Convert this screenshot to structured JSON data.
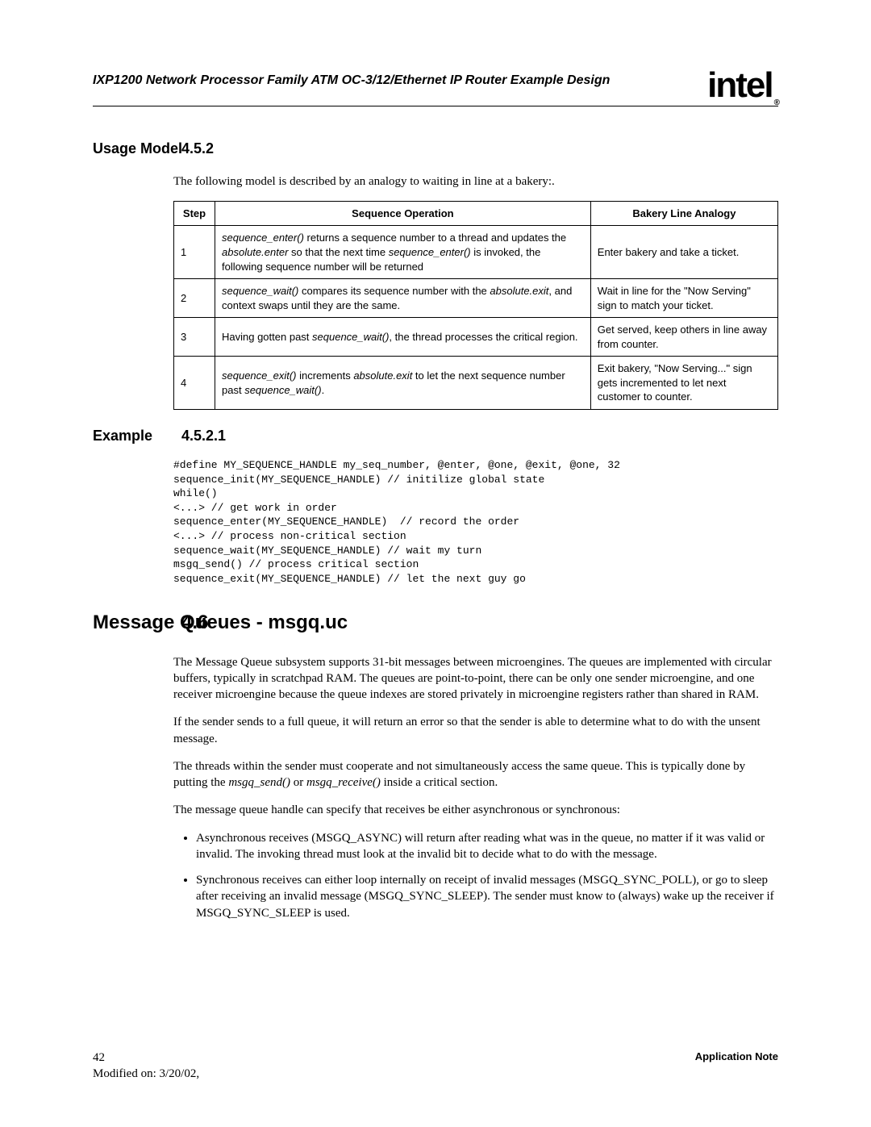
{
  "running_title": "IXP1200 Network Processor Family ATM OC-3/12/Ethernet IP Router Example Design",
  "logo_text": "intel",
  "logo_reg": "®",
  "sec452": {
    "num": "4.5.2",
    "title": "Usage Model"
  },
  "sec452_intro": "The following model is described by an analogy to waiting in line at a bakery:.",
  "table": {
    "h1": "Step",
    "h2": "Sequence Operation",
    "h3": "Bakery Line Analogy",
    "rows": [
      {
        "step": "1",
        "op_html": "<span class='em'>sequence_enter()</span> returns a sequence number to a thread and updates the <span class='em'>absolute.enter</span> so that the next time <span class='em'>sequence_enter()</span> is invoked, the following sequence number will be returned",
        "an": "Enter bakery and take a ticket."
      },
      {
        "step": "2",
        "op_html": "<span class='em'>sequence_wait()</span> compares its sequence number with the <span class='em'>absolute.exit</span>, and context swaps until they are the same.",
        "an": "Wait in line for the \"Now Serving\" sign to match your ticket."
      },
      {
        "step": "3",
        "op_html": "Having gotten past <span class='em'>sequence_wait()</span>, the thread processes the critical region.",
        "an": "Get served, keep others in line away from counter."
      },
      {
        "step": "4",
        "op_html": "<span class='em'>sequence_exit()</span> increments <span class='em'>absolute.exit</span> to let the next sequence number past <span class='em'>sequence_wait()</span>.",
        "an": "Exit bakery, \"Now Serving...\" sign gets incremented to let next customer to counter."
      }
    ]
  },
  "sec4521": {
    "num": "4.5.2.1",
    "title": "Example"
  },
  "code": "#define MY_SEQUENCE_HANDLE my_seq_number, @enter, @one, @exit, @one, 32\nsequence_init(MY_SEQUENCE_HANDLE) // initilize global state\nwhile()\n<...> // get work in order\nsequence_enter(MY_SEQUENCE_HANDLE)  // record the order\n<...> // process non-critical section\nsequence_wait(MY_SEQUENCE_HANDLE) // wait my turn\nmsgq_send() // process critical section\nsequence_exit(MY_SEQUENCE_HANDLE) // let the next guy go",
  "sec46": {
    "num": "4.6",
    "title": "Message Queues - msgq.uc"
  },
  "p46_1": "The Message Queue subsystem supports 31-bit messages between microengines. The queues are implemented with circular buffers, typically in scratchpad RAM. The queues are point-to-point, there can be only one sender microengine, and one receiver microengine because the queue indexes are stored privately in microengine registers rather than shared in RAM.",
  "p46_2": "If the sender sends to a full queue, it will return an error so that the sender is able to determine what to do with the unsent message.",
  "p46_3_html": "The threads within the sender must cooperate and not simultaneously access the same queue. This is typically done by putting the <span class='em'>msgq_send()</span> or <span class='em'>msgq_receive()</span> inside a critical section.",
  "p46_4": "The message queue handle can specify that receives be either asynchronous or synchronous:",
  "bullets": [
    "Asynchronous receives (MSGQ_ASYNC) will return after reading what was in the queue, no matter if it was valid or invalid. The invoking thread must look at the invalid bit to decide what to do with the message.",
    "Synchronous receives can either loop internally on receipt of invalid messages (MSGQ_SYNC_POLL), or go to sleep after receiving an invalid message (MSGQ_SYNC_SLEEP). The sender must know to (always) wake up the receiver if MSGQ_SYNC_SLEEP is used."
  ],
  "footer": {
    "page": "42",
    "modified": "Modified on: 3/20/02,",
    "appnote": "Application Note"
  }
}
